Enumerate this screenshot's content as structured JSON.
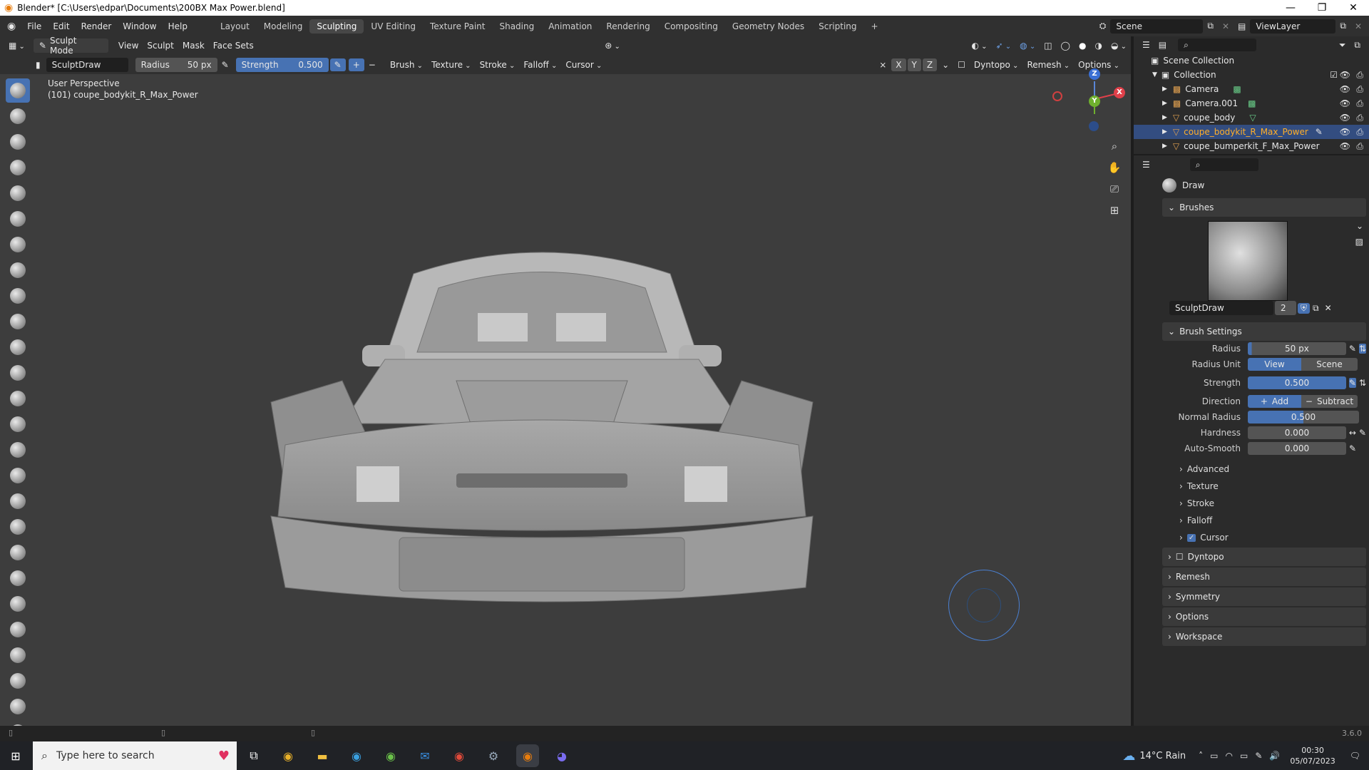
{
  "window": {
    "title": "Blender* [C:\\Users\\edpar\\Documents\\200BX Max Power.blend]"
  },
  "menu": {
    "items": [
      "File",
      "Edit",
      "Render",
      "Window",
      "Help"
    ]
  },
  "workspaces": [
    "Layout",
    "Modeling",
    "Sculpting",
    "UV Editing",
    "Texture Paint",
    "Shading",
    "Animation",
    "Rendering",
    "Compositing",
    "Geometry Nodes",
    "Scripting"
  ],
  "active_workspace": "Sculpting",
  "scene": {
    "label": "Scene",
    "view_layer": "ViewLayer"
  },
  "viewport_header": {
    "mode": "Sculpt Mode",
    "menus": [
      "View",
      "Sculpt",
      "Mask",
      "Face Sets"
    ]
  },
  "tool_settings": {
    "brush_name": "SculptDraw",
    "radius_label": "Radius",
    "radius_value": "50 px",
    "strength_label": "Strength",
    "strength_value": "0.500",
    "menus": [
      "Brush",
      "Texture",
      "Stroke",
      "Falloff",
      "Cursor"
    ],
    "axes": [
      "X",
      "Y",
      "Z"
    ],
    "right_menus": [
      "Dyntopo",
      "Remesh",
      "Options"
    ]
  },
  "viewport": {
    "perspective": "User Perspective",
    "object_info": "(101) coupe_bodykit_R_Max_Power"
  },
  "gizmo": {
    "z": "Z",
    "y": "Y",
    "x": "X"
  },
  "outliner": {
    "scene_collection": "Scene Collection",
    "collection": "Collection",
    "items": [
      {
        "name": "Camera",
        "type": "camera",
        "selected": false
      },
      {
        "name": "Camera.001",
        "type": "camera",
        "selected": false
      },
      {
        "name": "coupe_body",
        "type": "mesh",
        "selected": false
      },
      {
        "name": "coupe_bodykit_R_Max_Power",
        "type": "mesh",
        "selected": true
      },
      {
        "name": "coupe_bumperkit_F_Max_Power",
        "type": "mesh",
        "selected": false
      }
    ]
  },
  "properties": {
    "tool_name": "Draw",
    "brushes_panel": "Brushes",
    "brush_datablock": "SculptDraw",
    "brush_users": "2",
    "brush_settings_panel": "Brush Settings",
    "rows": {
      "radius": {
        "label": "Radius",
        "value": "50 px"
      },
      "radius_unit": {
        "label": "Radius Unit",
        "options": [
          "View",
          "Scene"
        ]
      },
      "strength": {
        "label": "Strength",
        "value": "0.500"
      },
      "direction": {
        "label": "Direction",
        "options": [
          "Add",
          "Subtract"
        ]
      },
      "normal_radius": {
        "label": "Normal Radius",
        "value": "0.500"
      },
      "hardness": {
        "label": "Hardness",
        "value": "0.000"
      },
      "auto_smooth": {
        "label": "Auto-Smooth",
        "value": "0.000"
      }
    },
    "subpanels": [
      "Advanced",
      "Texture",
      "Stroke",
      "Falloff",
      "Cursor"
    ],
    "panels": [
      "Dyntopo",
      "Remesh",
      "Symmetry",
      "Options",
      "Workspace"
    ]
  },
  "status": {
    "version": "3.6.0"
  },
  "taskbar": {
    "search_placeholder": "Type here to search",
    "weather": "14°C  Rain",
    "time": "00:30",
    "date": "05/07/2023"
  },
  "colors": {
    "accent": "#4772b3",
    "selected_row": "#334d80",
    "viewport_bg": "#3d3d3d"
  }
}
